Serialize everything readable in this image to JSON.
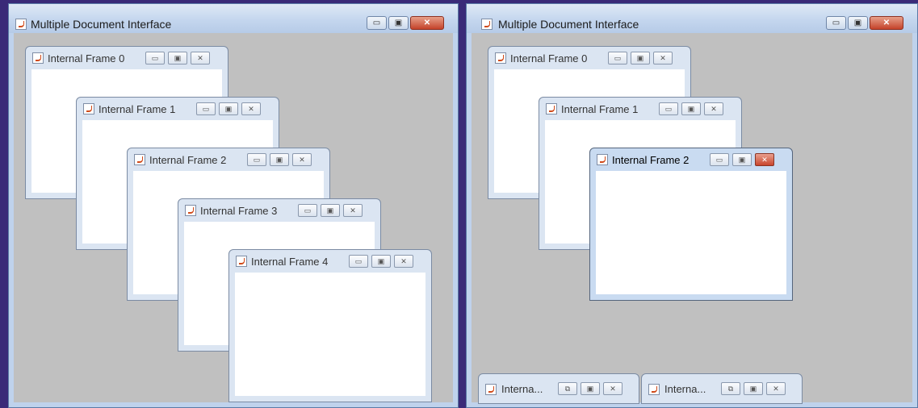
{
  "left_window": {
    "title": "Multiple Document Interface",
    "frames": [
      {
        "title": "Internal Frame 0"
      },
      {
        "title": "Internal Frame 1"
      },
      {
        "title": "Internal Frame 2"
      },
      {
        "title": "Internal Frame 3"
      },
      {
        "title": "Internal Frame 4"
      }
    ]
  },
  "right_window": {
    "title": "Multiple Document Interface",
    "frames": [
      {
        "title": "Internal Frame 0"
      },
      {
        "title": "Internal Frame 1"
      },
      {
        "title": "Internal Frame 2"
      }
    ],
    "iconified": [
      {
        "title": "Interna..."
      },
      {
        "title": "Interna..."
      }
    ]
  },
  "buttons": {
    "minimize": "▭",
    "maximize": "▣",
    "close": "✕",
    "restore": "⧉"
  }
}
